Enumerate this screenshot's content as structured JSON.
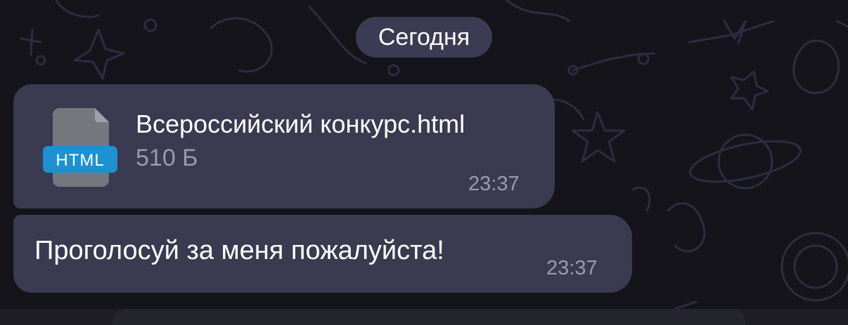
{
  "chat": {
    "date_separator": "Сегодня",
    "messages": [
      {
        "type": "file",
        "file_name": "Всероссийский конкурс.html",
        "file_size": "510 Б",
        "file_type_badge": "HTML",
        "file_icon": "html-file-icon",
        "time": "23:37"
      },
      {
        "type": "text",
        "text": "Проголосуй за меня пожалуйста!",
        "time": "23:37"
      }
    ]
  },
  "colors": {
    "background": "#15141b",
    "bubble": "#3a3a51",
    "date_pill": "#3b3b53",
    "meta_text": "#9b9bb0",
    "badge_blue": "#1d91d2"
  }
}
